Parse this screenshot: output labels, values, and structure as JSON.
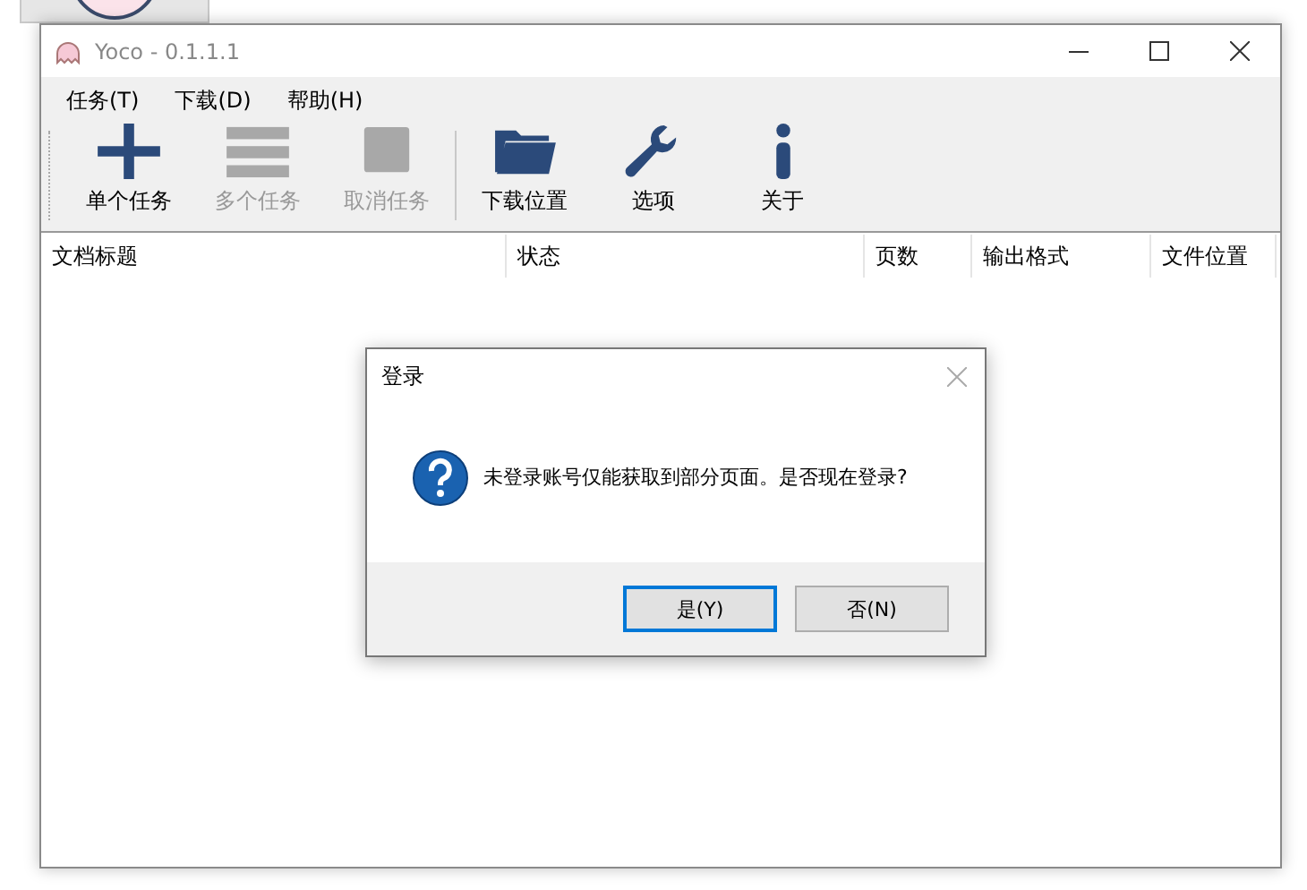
{
  "window": {
    "title": "Yoco - 0.1.1.1"
  },
  "menu": [
    {
      "label": "任务(T)"
    },
    {
      "label": "下载(D)"
    },
    {
      "label": "帮助(H)"
    }
  ],
  "toolbar": {
    "items": [
      {
        "kind": "plus",
        "label": "单个任务",
        "disabled": false
      },
      {
        "kind": "list",
        "label": "多个任务",
        "disabled": true
      },
      {
        "kind": "stop",
        "label": "取消任务",
        "disabled": true
      },
      {
        "kind": "folder",
        "label": "下载位置",
        "disabled": false
      },
      {
        "kind": "wrench",
        "label": "选项",
        "disabled": false
      },
      {
        "kind": "info",
        "label": "关于",
        "disabled": false
      }
    ]
  },
  "table": {
    "columns": [
      "文档标题",
      "状态",
      "页数",
      "输出格式",
      "文件位置"
    ]
  },
  "dialog": {
    "title": "登录",
    "message": "未登录账号仅能获取到部分页面。是否现在登录?",
    "buttons": [
      {
        "label": "是(Y)",
        "selected": true
      },
      {
        "label": "否(N)",
        "selected": false
      }
    ]
  }
}
